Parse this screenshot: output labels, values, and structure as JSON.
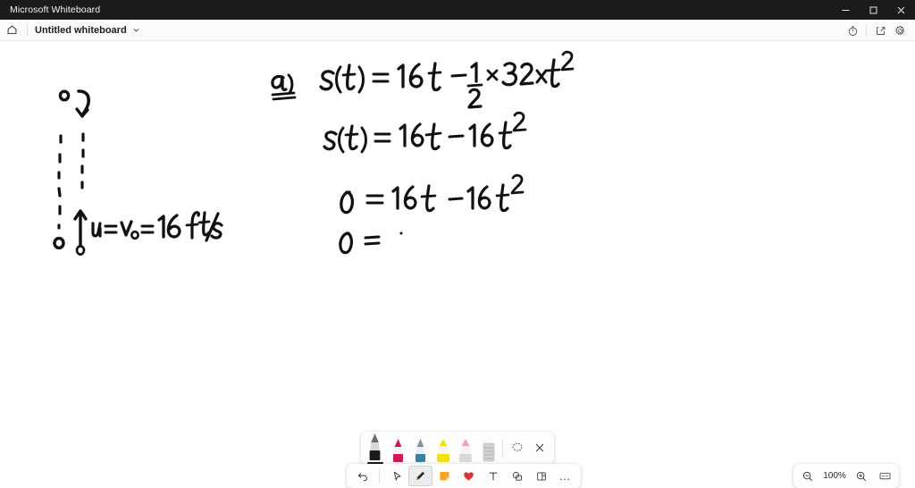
{
  "window": {
    "title": "Microsoft Whiteboard",
    "controls": [
      {
        "name": "minimize",
        "label": "Minimize"
      },
      {
        "name": "maximize",
        "label": "Maximize"
      },
      {
        "name": "close",
        "label": "Close"
      }
    ]
  },
  "appbar": {
    "home_icon": "home-icon",
    "doc_title": "Untitled whiteboard",
    "chevron": "chevron-down-icon",
    "right_icons": [
      {
        "name": "timer-icon",
        "label": "Timer"
      },
      {
        "name": "share-icon",
        "label": "Share"
      },
      {
        "name": "settings-gear-icon",
        "label": "Settings"
      }
    ]
  },
  "canvas": {
    "ink_notes": {
      "diagram_label": "u = v₀ = 16 ft/s",
      "line_a_label": "a)",
      "line_1": "s(t) = 16t - 1/2 × 32×t²",
      "line_2": "s(t) = 16t - 16t²",
      "line_3": "0 = 16t - 16t²",
      "line_4": "0 ="
    }
  },
  "pen_tray": {
    "pens": [
      {
        "name": "pen-black",
        "label": "Black pen",
        "color": "#1a1a1a",
        "type": "pen",
        "selected": true
      },
      {
        "name": "pen-pink",
        "label": "Pink pen",
        "color": "#d1195a",
        "type": "pen",
        "selected": false
      },
      {
        "name": "pen-blue",
        "label": "Blue pen",
        "color": "#3b7fa6",
        "type": "pen",
        "selected": false
      },
      {
        "name": "highlighter-yellow",
        "label": "Yellow highlighter",
        "color": "#f2e20c",
        "type": "highlighter",
        "selected": false
      },
      {
        "name": "highlighter-pink",
        "label": "Pink highlighter",
        "color": "#f0a0b8",
        "type": "highlighter",
        "selected": false
      },
      {
        "name": "eraser",
        "label": "Eraser",
        "color": "#c9c9c9",
        "type": "eraser",
        "selected": false
      }
    ],
    "lasso_label": "Lasso select",
    "close_label": "Close"
  },
  "toolbar": {
    "undo_label": "Undo",
    "select_label": "Select",
    "pen_label": "Pen",
    "note_label": "Note",
    "reaction_label": "Reaction",
    "text_label": "Text",
    "shapes_label": "Shapes",
    "table_label": "Table",
    "more_label": "…",
    "note_color": "#f5a623",
    "reaction_color": "#e03131"
  },
  "zoom": {
    "out_label": "Zoom out",
    "level": "100%",
    "in_label": "Zoom in",
    "fit_label": "Fit to screen"
  }
}
